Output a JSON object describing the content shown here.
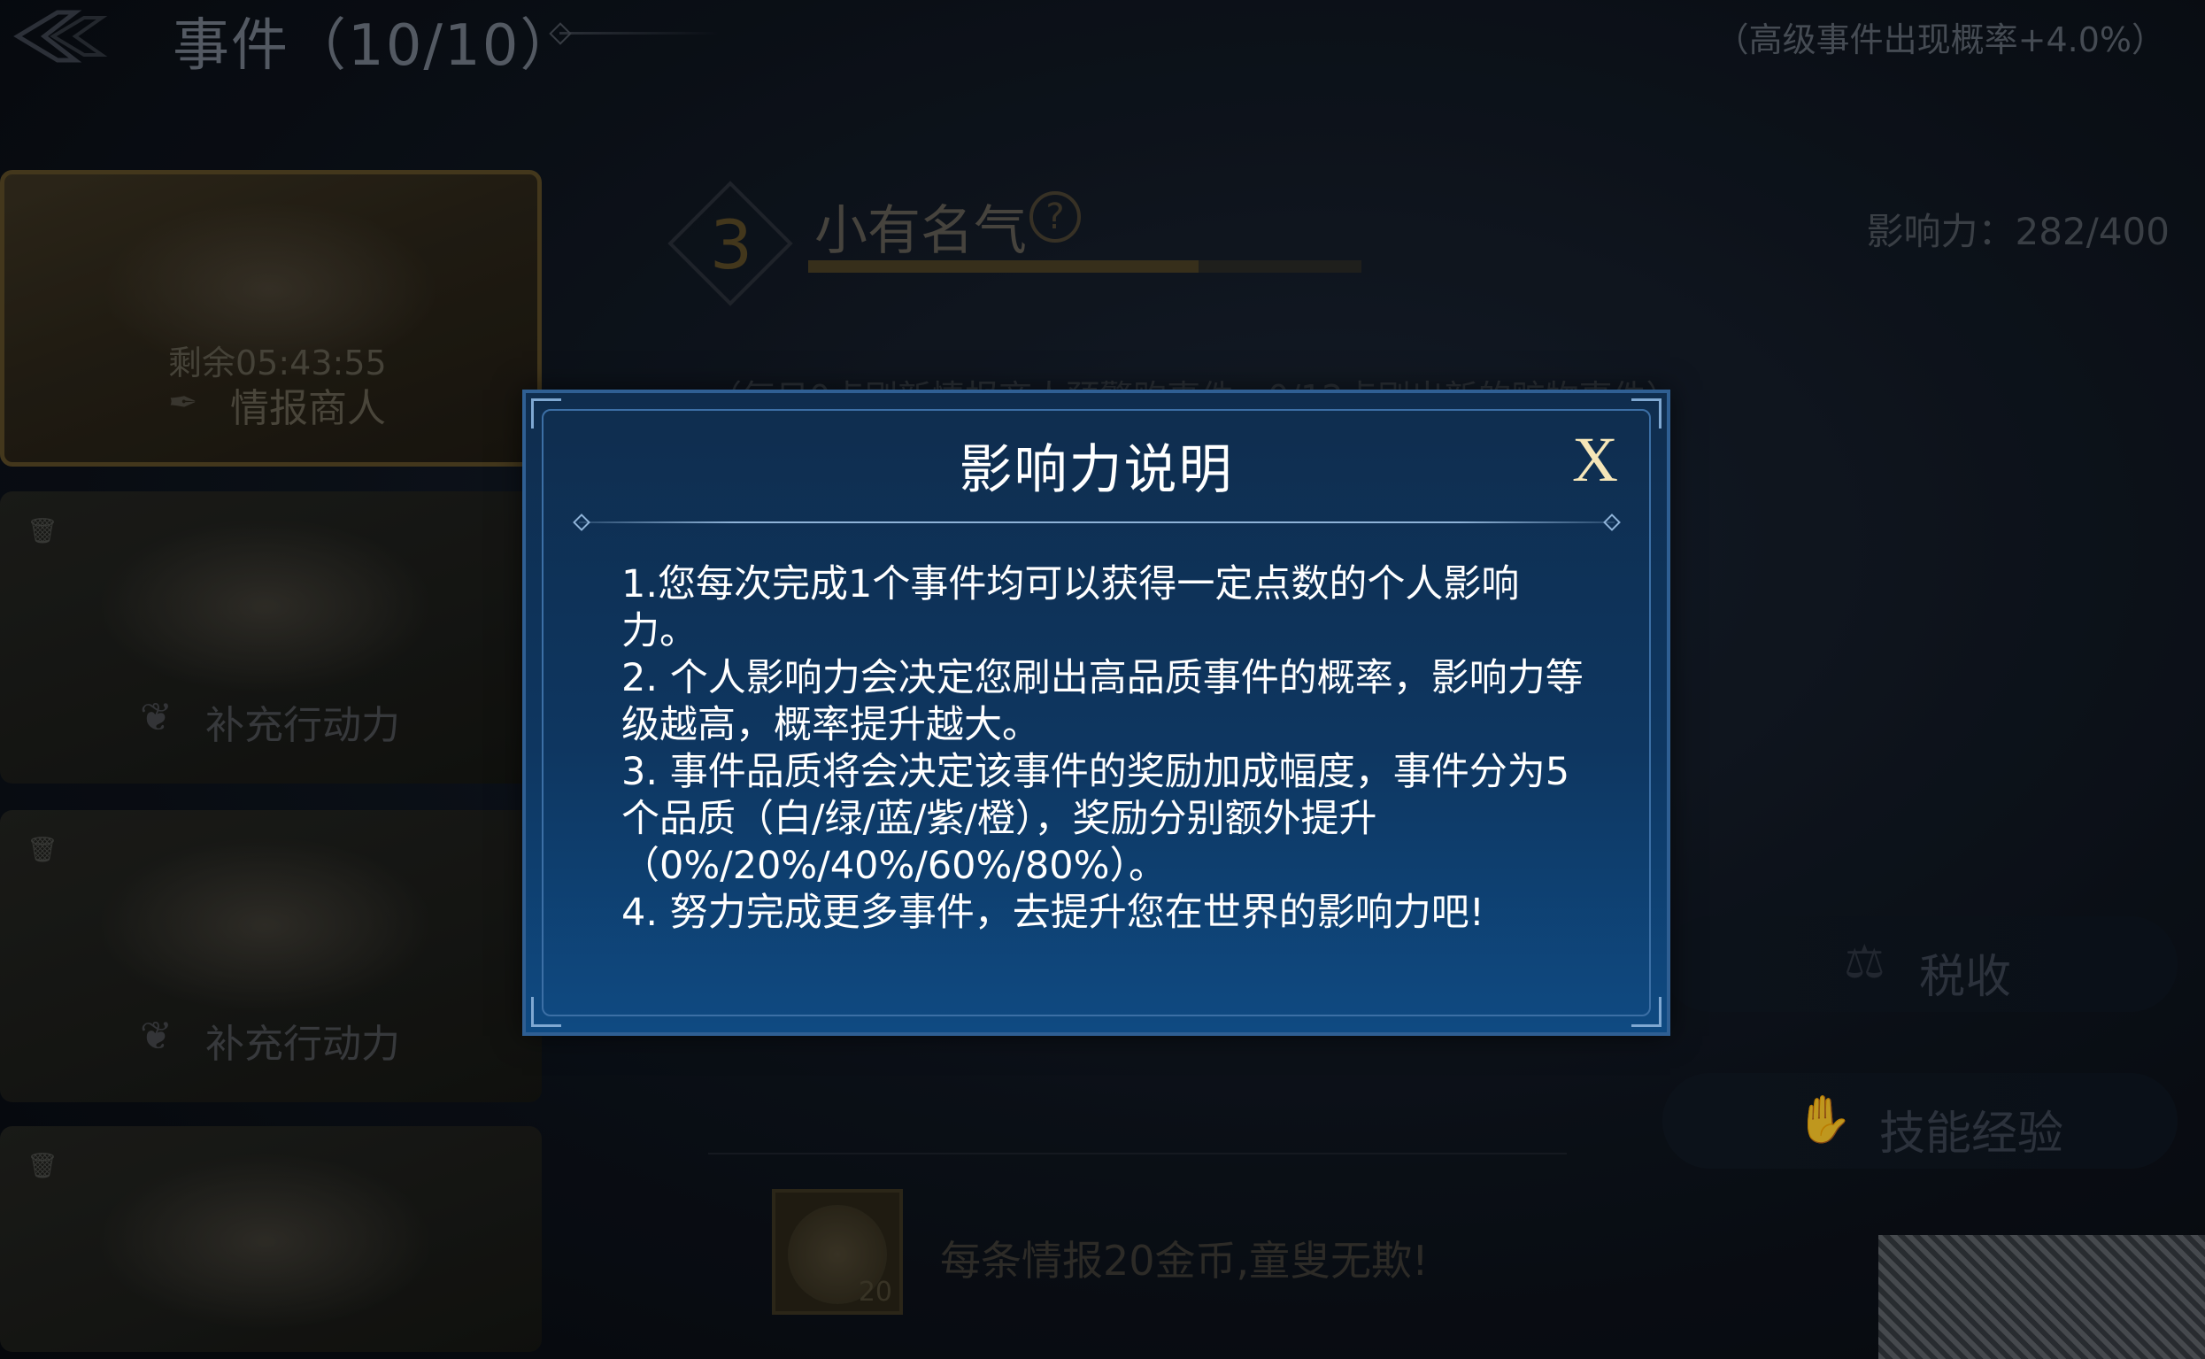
{
  "header": {
    "title": "事件（10/10）",
    "probability_hint": "（高级事件出现概率+4.0%）"
  },
  "event_cards": [
    {
      "timer": "剩余05:43:55",
      "name": "情报商人"
    },
    {
      "action": "补充行动力"
    },
    {
      "action": "补充行动力"
    }
  ],
  "level": {
    "number": "3",
    "name": "小有名气",
    "influence": "影响力：282/400",
    "progress_fraction": 0.705
  },
  "refresh_note": "（每日0点刷新情报商人预警购事件，0/12点刷出新的赃物事件）",
  "side_buttons": {
    "tax": "税收",
    "skill_exp": "技能经验"
  },
  "coin_offer": {
    "count": "20",
    "text": "每条情报20金币,童叟无欺!"
  },
  "dialog": {
    "title": "影响力说明",
    "close_label": "X",
    "lines": [
      "1.您每次完成1个事件均可以获得一定点数的个人影响力。",
      "2. 个人影响力会决定您刷出高品质事件的概率，影响力等级越高，概率提升越大。",
      "3. 事件品质将会决定该事件的奖励加成幅度，事件分为5个品质（白/绿/蓝/紫/橙），奖励分别额外提升（0%/20%/40%/60%/80%）。",
      "4. 努力完成更多事件，去提升您在世界的影响力吧!"
    ]
  },
  "colors": {
    "dialog_bg": "#0e3660",
    "dialog_border": "#2f5f93",
    "close_x": "#f6e6b8",
    "gold_accent": "#5a4a26"
  }
}
